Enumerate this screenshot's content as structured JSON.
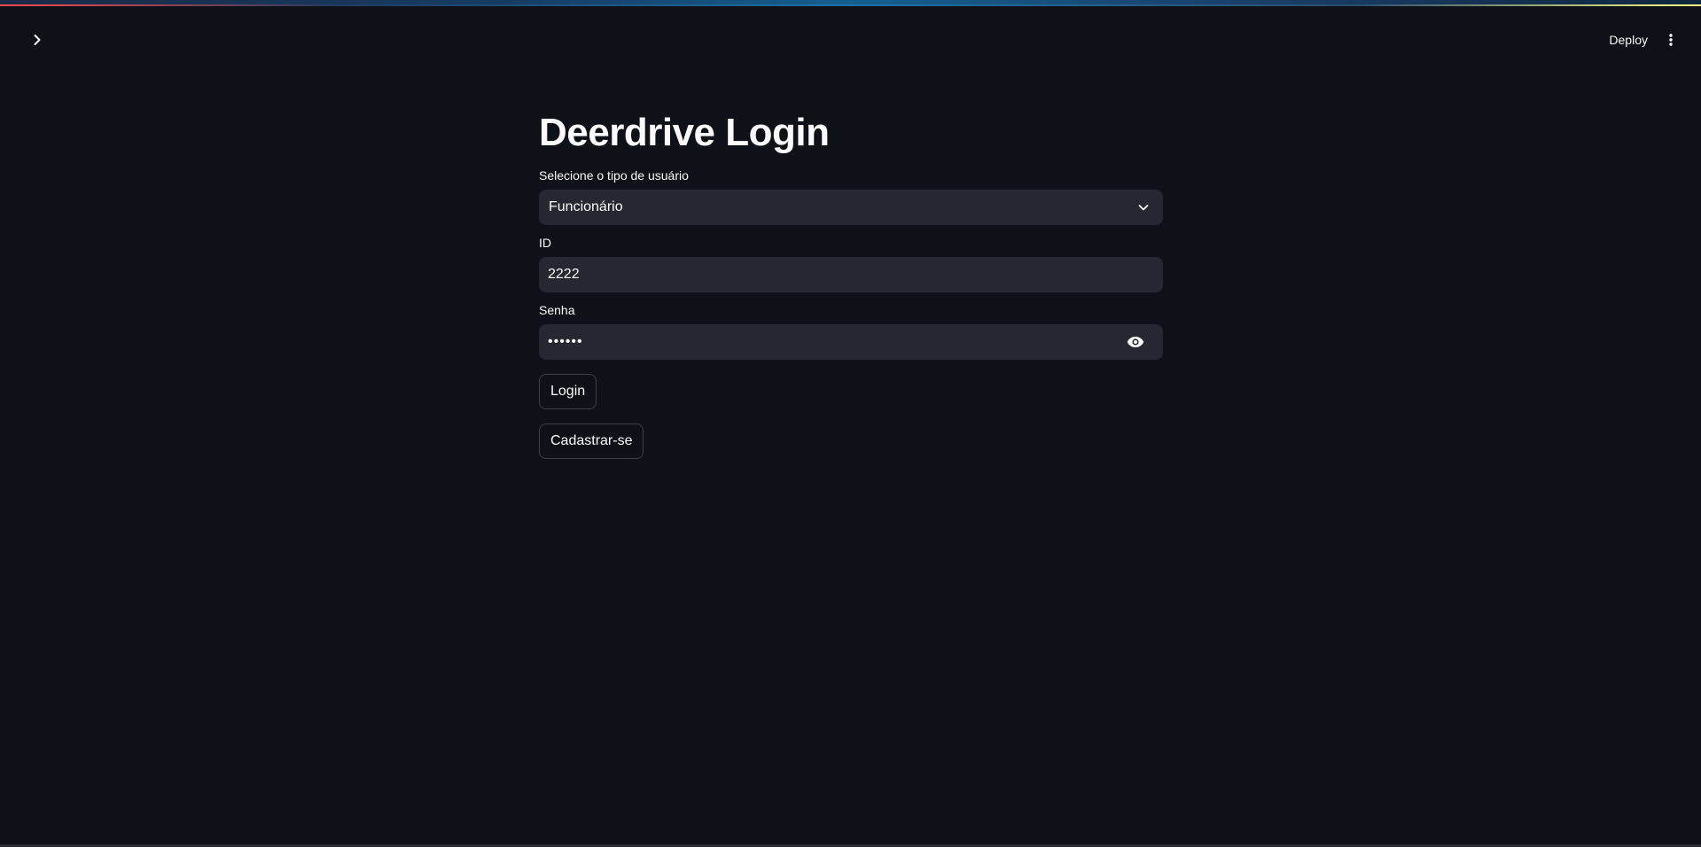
{
  "header": {
    "deploy_label": "Deploy",
    "sidebar_toggle_icon": "chevron-right-icon",
    "menu_icon": "more-vertical-icon"
  },
  "main": {
    "title": "Deerdrive Login",
    "user_type": {
      "label": "Selecione o tipo de usuário",
      "value": "Funcionário",
      "icon": "chevron-down-icon"
    },
    "id_field": {
      "label": "ID",
      "value": "2222"
    },
    "password_field": {
      "label": "Senha",
      "value": "••••••",
      "icon": "eye-icon"
    },
    "login_label": "Login",
    "register_label": "Cadastrar-se"
  },
  "colors": {
    "background": "#0e1117",
    "input_background": "#262730",
    "text": "#fafafa"
  }
}
